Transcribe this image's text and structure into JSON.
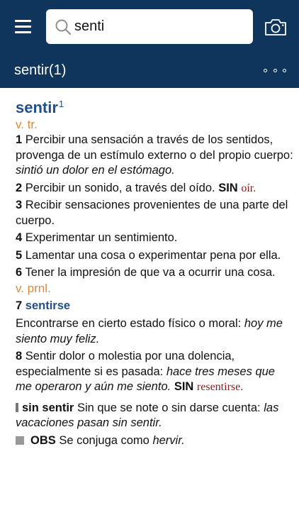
{
  "search": {
    "value": "senti"
  },
  "header": {
    "entry_title": "sentir(1)"
  },
  "entry": {
    "headword": "sentir",
    "homonym": "1",
    "gram1": "v. tr.",
    "senses_tr": [
      {
        "n": "1",
        "text": "Percibir una sensación a través de los sentidos, provenga de un estímulo externo o del propio cuerpo:",
        "example": "sintió un dolor en el estómago.",
        "sin": "",
        "sin_word": ""
      },
      {
        "n": "2",
        "text": "Percibir un sonido, a través del oído.",
        "example": "",
        "sin": "SIN",
        "sin_word": "oír."
      },
      {
        "n": "3",
        "text": "Recibir sensaciones provenientes de una parte del cuerpo.",
        "example": "",
        "sin": "",
        "sin_word": ""
      },
      {
        "n": "4",
        "text": "Experimentar un sentimiento.",
        "example": "",
        "sin": "",
        "sin_word": ""
      },
      {
        "n": "5",
        "text": "Lamentar una cosa o experimentar pena por ella.",
        "example": "",
        "sin": "",
        "sin_word": ""
      },
      {
        "n": "6",
        "text": "Tener la impresión de que va a ocurrir una cosa.",
        "example": "",
        "sin": "",
        "sin_word": ""
      }
    ],
    "gram2": "v. prnl.",
    "sense7": {
      "n": "7",
      "lemma": "sentirse",
      "text": "Encontrarse en cierto estado físico o moral:",
      "example": "hoy me siento muy feliz."
    },
    "sense8": {
      "n": "8",
      "text": "Sentir dolor o molestia por una dolencia, especialmente si es pasada:",
      "example": "hace tres meses que me operaron y aún me siento.",
      "sin": "SIN",
      "sin_word": "resentirse."
    },
    "phrase": {
      "term": "sin sentir",
      "definition": "Sin que se note o sin darse cuenta:",
      "example": "las vacaciones pasan sin sentir."
    },
    "obs": {
      "label": "OBS",
      "text": "Se conjuga como",
      "example": "hervir."
    }
  }
}
